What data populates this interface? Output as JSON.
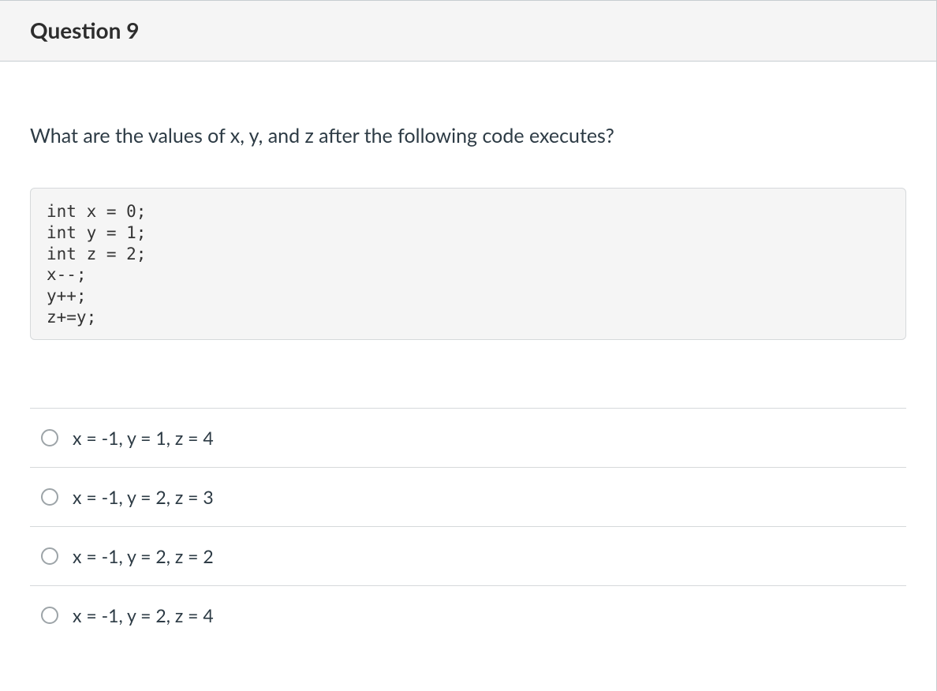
{
  "header": {
    "title": "Question 9"
  },
  "prompt": "What are the values of x, y, and z after the following code executes?",
  "code": "int x = 0;\nint y = 1;\nint z = 2;\nx--;\ny++;\nz+=y;",
  "answers": [
    {
      "label": "x = -1, y = 1, z = 4",
      "selected": false
    },
    {
      "label": "x = -1, y = 2, z = 3",
      "selected": false
    },
    {
      "label": "x = -1, y = 2, z = 2",
      "selected": false
    },
    {
      "label": "x = -1, y = 2, z = 4",
      "selected": false
    }
  ]
}
